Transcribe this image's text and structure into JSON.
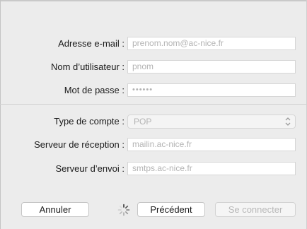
{
  "form": {
    "email": {
      "label": "Adresse e-mail :",
      "placeholder": "prenom.nom@ac-nice.fr"
    },
    "username": {
      "label": "Nom d’utilisateur :",
      "placeholder": "pnom"
    },
    "password": {
      "label": "Mot de passe :",
      "placeholder": "••••••"
    },
    "account_type": {
      "label": "Type de compte :",
      "value": "POP"
    },
    "incoming_server": {
      "label": "Serveur de réception :",
      "placeholder": "mailin.ac-nice.fr"
    },
    "outgoing_server": {
      "label": "Serveur d’envoi :",
      "placeholder": "smtps.ac-nice.fr"
    }
  },
  "buttons": {
    "cancel": "Annuler",
    "previous": "Précédent",
    "connect": "Se connecter"
  },
  "icons": {
    "spinner": "loading-spinner-icon",
    "select_arrows": "up-down-chevron-icon"
  }
}
